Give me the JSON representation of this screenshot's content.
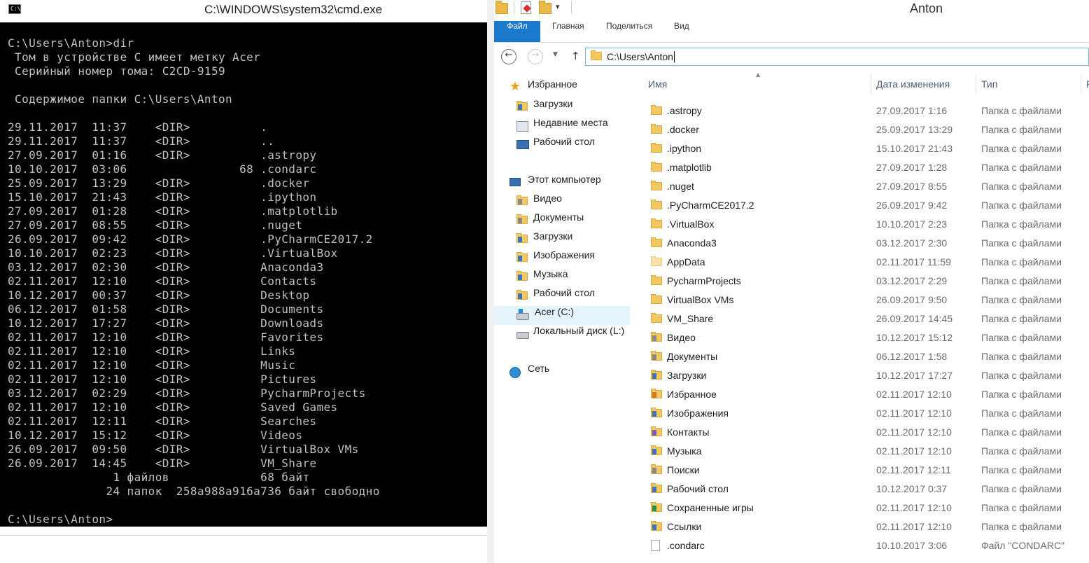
{
  "cmd": {
    "title": "C:\\WINDOWS\\system32\\cmd.exe",
    "icon_text": "C:\\",
    "lines": [
      "C:\\Users\\Anton>dir",
      " Том в устройстве C имеет метку Acer",
      " Серийный номер тома: C2CD-9159",
      "",
      " Содержимое папки C:\\Users\\Anton",
      "",
      "29.11.2017  11:37    <DIR>          .",
      "29.11.2017  11:37    <DIR>          ..",
      "27.09.2017  01:16    <DIR>          .astropy",
      "10.10.2017  03:06                68 .condarc",
      "25.09.2017  13:29    <DIR>          .docker",
      "15.10.2017  21:43    <DIR>          .ipython",
      "27.09.2017  01:28    <DIR>          .matplotlib",
      "27.09.2017  08:55    <DIR>          .nuget",
      "26.09.2017  09:42    <DIR>          .PyCharmCE2017.2",
      "10.10.2017  02:23    <DIR>          .VirtualBox",
      "03.12.2017  02:30    <DIR>          Anaconda3",
      "02.11.2017  12:10    <DIR>          Contacts",
      "10.12.2017  00:37    <DIR>          Desktop",
      "06.12.2017  01:58    <DIR>          Documents",
      "10.12.2017  17:27    <DIR>          Downloads",
      "02.11.2017  12:10    <DIR>          Favorites",
      "02.11.2017  12:10    <DIR>          Links",
      "02.11.2017  12:10    <DIR>          Music",
      "02.11.2017  12:10    <DIR>          Pictures",
      "03.12.2017  02:29    <DIR>          PycharmProjects",
      "02.11.2017  12:10    <DIR>          Saved Games",
      "02.11.2017  12:11    <DIR>          Searches",
      "10.12.2017  15:12    <DIR>          Videos",
      "26.09.2017  09:50    <DIR>          VirtualBox VMs",
      "26.09.2017  14:45    <DIR>          VM_Share",
      "               1 файлов             68 байт",
      "              24 папок  258a988a916a736 байт свободно",
      "",
      "C:\\Users\\Anton>"
    ]
  },
  "explorer": {
    "window_title": "Anton",
    "ribbon_tabs": [
      "Файл",
      "Главная",
      "Поделиться",
      "Вид"
    ],
    "address": "C:\\Users\\Anton",
    "nav": {
      "favorites": "Избранное",
      "favorites_items": [
        "Загрузки",
        "Недавние места",
        "Рабочий стол"
      ],
      "this_pc": "Этот компьютер",
      "this_pc_items": [
        "Видео",
        "Документы",
        "Загрузки",
        "Изображения",
        "Музыка",
        "Рабочий стол",
        "Acer (C:)",
        "Локальный диск (L:)"
      ],
      "network": "Сеть"
    },
    "columns": {
      "name": "Имя",
      "date": "Дата изменения",
      "type": "Тип",
      "extra": "Р"
    },
    "files": [
      {
        "name": ".astropy",
        "date": "27.09.2017 1:16",
        "type": "Папка с файлами"
      },
      {
        "name": ".docker",
        "date": "25.09.2017 13:29",
        "type": "Папка с файлами"
      },
      {
        "name": ".ipython",
        "date": "15.10.2017 21:43",
        "type": "Папка с файлами"
      },
      {
        "name": ".matplotlib",
        "date": "27.09.2017 1:28",
        "type": "Папка с файлами"
      },
      {
        "name": ".nuget",
        "date": "27.09.2017 8:55",
        "type": "Папка с файлами"
      },
      {
        "name": ".PyCharmCE2017.2",
        "date": "26.09.2017 9:42",
        "type": "Папка с файлами"
      },
      {
        "name": ".VirtualBox",
        "date": "10.10.2017 2:23",
        "type": "Папка с файлами"
      },
      {
        "name": "Anaconda3",
        "date": "03.12.2017 2:30",
        "type": "Папка с файлами"
      },
      {
        "name": "AppData",
        "date": "02.11.2017 11:59",
        "type": "Папка с файлами"
      },
      {
        "name": "PycharmProjects",
        "date": "03.12.2017 2:29",
        "type": "Папка с файлами"
      },
      {
        "name": "VirtualBox VMs",
        "date": "26.09.2017 9:50",
        "type": "Папка с файлами"
      },
      {
        "name": "VM_Share",
        "date": "26.09.2017 14:45",
        "type": "Папка с файлами"
      },
      {
        "name": "Видео",
        "date": "10.12.2017 15:12",
        "type": "Папка с файлами"
      },
      {
        "name": "Документы",
        "date": "06.12.2017 1:58",
        "type": "Папка с файлами"
      },
      {
        "name": "Загрузки",
        "date": "10.12.2017 17:27",
        "type": "Папка с файлами"
      },
      {
        "name": "Избранное",
        "date": "02.11.2017 12:10",
        "type": "Папка с файлами"
      },
      {
        "name": "Изображения",
        "date": "02.11.2017 12:10",
        "type": "Папка с файлами"
      },
      {
        "name": "Контакты",
        "date": "02.11.2017 12:10",
        "type": "Папка с файлами"
      },
      {
        "name": "Музыка",
        "date": "02.11.2017 12:10",
        "type": "Папка с файлами"
      },
      {
        "name": "Поиски",
        "date": "02.11.2017 12:11",
        "type": "Папка с файлами"
      },
      {
        "name": "Рабочий стол",
        "date": "10.12.2017 0:37",
        "type": "Папка с файлами"
      },
      {
        "name": "Сохраненные игры",
        "date": "02.11.2017 12:10",
        "type": "Папка с файлами"
      },
      {
        "name": "Ссылки",
        "date": "02.11.2017 12:10",
        "type": "Папка с файлами"
      },
      {
        "name": ".condarc",
        "date": "10.10.2017 3:06",
        "type": "Файл \"CONDARC\""
      }
    ]
  }
}
